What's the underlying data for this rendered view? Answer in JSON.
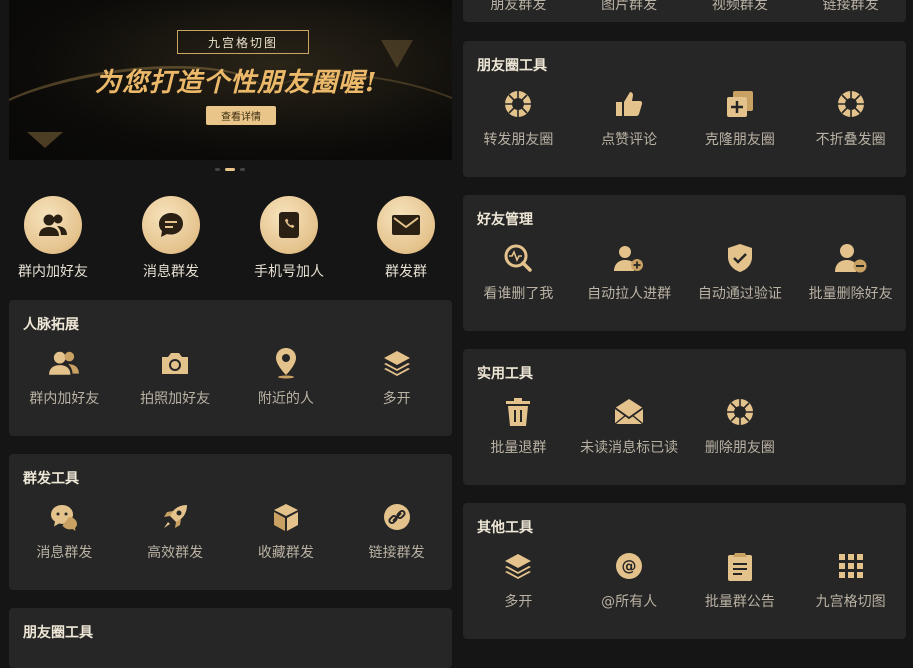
{
  "banner": {
    "tag": "九宫格切图",
    "headline": "为您打造个性朋友圈喔!",
    "cta": "查看详情"
  },
  "quick_actions": [
    {
      "label": "群内加好友",
      "icon": "group-users-icon"
    },
    {
      "label": "消息群发",
      "icon": "chat-bubble-icon"
    },
    {
      "label": "手机号加人",
      "icon": "phone-book-icon"
    },
    {
      "label": "群发群",
      "icon": "envelope-icon"
    }
  ],
  "left_cards": [
    {
      "title": "人脉拓展",
      "items": [
        {
          "label": "群内加好友",
          "icon": "group-users-icon"
        },
        {
          "label": "拍照加好友",
          "icon": "camera-icon"
        },
        {
          "label": "附近的人",
          "icon": "location-pin-icon"
        },
        {
          "label": "多开",
          "icon": "layers-icon"
        }
      ]
    },
    {
      "title": "群发工具",
      "items": [
        {
          "label": "消息群发",
          "icon": "chat-face-icon"
        },
        {
          "label": "高效群发",
          "icon": "rocket-icon"
        },
        {
          "label": "收藏群发",
          "icon": "box-icon"
        },
        {
          "label": "链接群发",
          "icon": "link-icon"
        }
      ]
    },
    {
      "title": "朋友圈工具",
      "items": []
    }
  ],
  "right_top_partial": [
    "朋友群发",
    "图片群发",
    "视频群发",
    "链接群发"
  ],
  "right_cards": [
    {
      "title": "朋友圈工具",
      "items": [
        {
          "label": "转发朋友圈",
          "icon": "aperture-icon"
        },
        {
          "label": "点赞评论",
          "icon": "thumbs-up-icon"
        },
        {
          "label": "克隆朋友圈",
          "icon": "clone-icon"
        },
        {
          "label": "不折叠发圈",
          "icon": "aperture-icon"
        }
      ]
    },
    {
      "title": "好友管理",
      "items": [
        {
          "label": "看谁删了我",
          "icon": "search-pulse-icon"
        },
        {
          "label": "自动拉人进群",
          "icon": "add-user-icon"
        },
        {
          "label": "自动通过验证",
          "icon": "shield-check-icon"
        },
        {
          "label": "批量删除好友",
          "icon": "remove-user-icon"
        }
      ]
    },
    {
      "title": "实用工具",
      "items": [
        {
          "label": "批量退群",
          "icon": "trash-icon"
        },
        {
          "label": "未读消息标已读",
          "icon": "mail-open-icon"
        },
        {
          "label": "删除朋友圈",
          "icon": "aperture-icon"
        },
        {
          "label": "",
          "icon": ""
        }
      ]
    },
    {
      "title": "其他工具",
      "items": [
        {
          "label": "多开",
          "icon": "layers-icon"
        },
        {
          "label": "@所有人",
          "icon": "at-sign-icon"
        },
        {
          "label": "批量群公告",
          "icon": "clipboard-icon"
        },
        {
          "label": "九宫格切图",
          "icon": "grid-icon"
        }
      ]
    }
  ],
  "colors": {
    "accent": "#e4c28c",
    "card": "#262626",
    "background": "#151515"
  }
}
